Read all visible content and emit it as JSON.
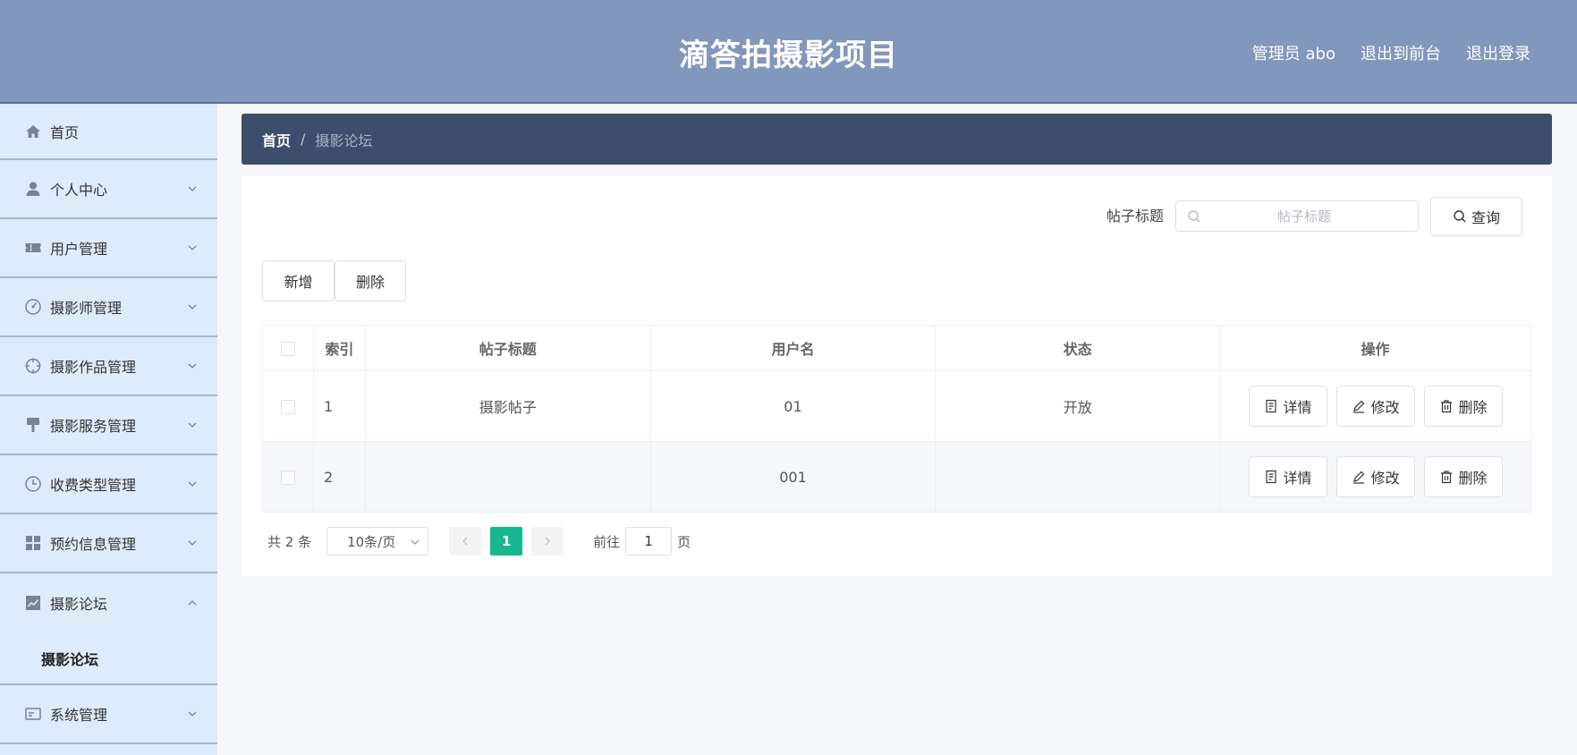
{
  "header": {
    "title": "滴答拍摄影项目",
    "user_label": "管理员 abo",
    "to_front_label": "退出到前台",
    "logout_label": "退出登录"
  },
  "sidebar": {
    "items": [
      {
        "label": "首页",
        "icon": "home-icon"
      },
      {
        "label": "个人中心",
        "icon": "user-icon"
      },
      {
        "label": "用户管理",
        "icon": "ticket-icon"
      },
      {
        "label": "摄影师管理",
        "icon": "gauge-icon"
      },
      {
        "label": "摄影作品管理",
        "icon": "crosshair-icon"
      },
      {
        "label": "摄影服务管理",
        "icon": "brush-icon"
      },
      {
        "label": "收费类型管理",
        "icon": "clock-icon"
      },
      {
        "label": "预约信息管理",
        "icon": "grid-icon"
      },
      {
        "label": "摄影论坛",
        "icon": "chart-icon"
      },
      {
        "label": "系统管理",
        "icon": "card-icon"
      }
    ],
    "submenu_forum": "摄影论坛"
  },
  "breadcrumb": {
    "home": "首页",
    "separator": "/",
    "current": "摄影论坛"
  },
  "search": {
    "label": "帖子标题",
    "placeholder": "帖子标题",
    "value": "",
    "query_label": "查询"
  },
  "actions": {
    "add_label": "新增",
    "delete_label": "删除"
  },
  "table": {
    "headers": [
      "",
      "索引",
      "帖子标题",
      "用户名",
      "状态",
      "操作"
    ],
    "rows": [
      {
        "index": "1",
        "title": "摄影帖子",
        "username": "01",
        "status": "开放"
      },
      {
        "index": "2",
        "title": "",
        "username": "001",
        "status": ""
      }
    ],
    "op_detail": "详情",
    "op_edit": "修改",
    "op_delete": "删除"
  },
  "pagination": {
    "total": "共 2 条",
    "page_size": "10条/页",
    "current_page": "1",
    "goto_label": "前往",
    "goto_value": "1",
    "page_suffix": "页"
  },
  "colors": {
    "header_bg": "#8197bb",
    "sidebar_bg": "#deebfb",
    "breadcrumb_bg": "#3c4e6b",
    "accent": "#17b890"
  }
}
